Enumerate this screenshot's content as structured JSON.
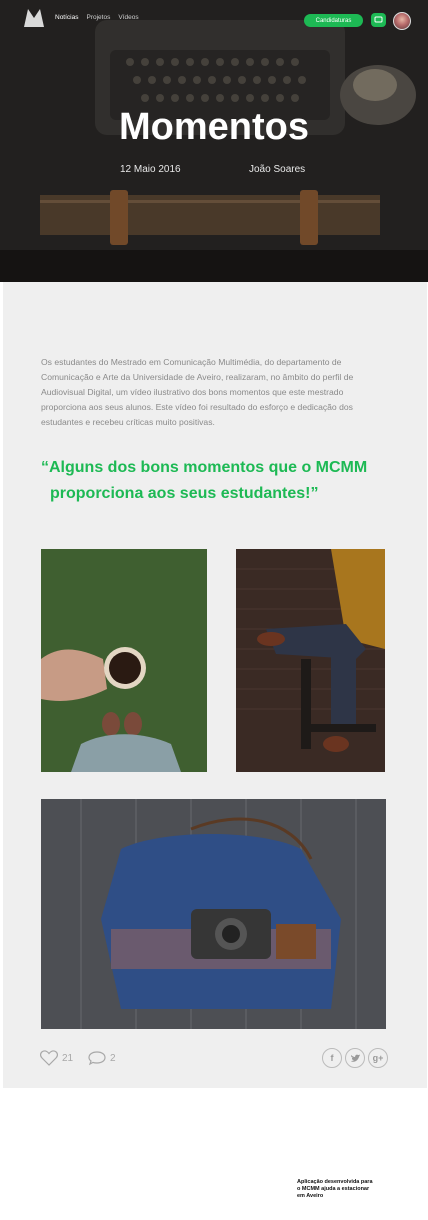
{
  "nav": {
    "links": [
      "Notícias",
      "Projetos",
      "Vídeos"
    ],
    "cta_label": "Candidaturas"
  },
  "hero": {
    "title": "Momentos",
    "date": "12 Maio 2016",
    "author": "João Soares"
  },
  "article": {
    "intro": "Os estudantes do Mestrado em Comunicação Multimédia, do departamento de Comunicação e Arte da Universidade de Aveiro, realizaram, no âmbito do perfil de Audiovisual Digital, um vídeo ilustrativo dos bons momentos que este mestrado proporciona aos seus alunos. Este vídeo foi resultado do esforço e dedicação dos estudantes e recebeu críticas muito positivas.",
    "quote_line1": "“Alguns dos bons momentos que o MCMM",
    "quote_line2": "proporciona aos seus estudantes!”"
  },
  "social": {
    "likes": "21",
    "comments": "2",
    "share_icons": [
      "facebook-icon",
      "twitter-icon",
      "google-plus-icon"
    ]
  },
  "footer": {
    "note": "Aplicação desenvolvida para o MCMM ajuda a estacionar em Aveiro"
  },
  "colors": {
    "accent": "#1db954",
    "panel_bg": "#efefef",
    "body_text": "#8a8a8a"
  }
}
